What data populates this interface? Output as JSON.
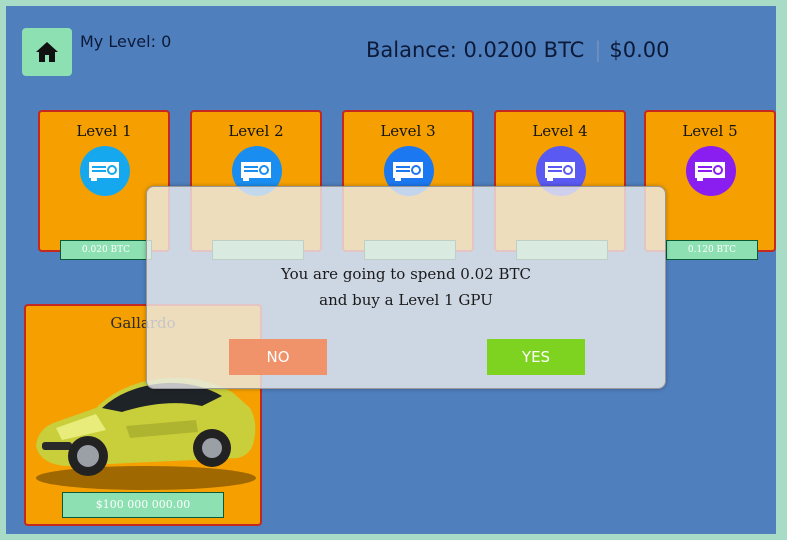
{
  "header": {
    "home_icon": "home-icon",
    "my_level": "My Level: 0",
    "balance": "Balance: 0.0200 BTC",
    "separator": "|",
    "usd": "$0.00"
  },
  "levels": [
    {
      "label": "Level 1",
      "price": "0.020 BTC",
      "color": "#16a8ee",
      "icon": "gpu-icon"
    },
    {
      "label": "Level 2",
      "price": "",
      "color": "#1a8ef0",
      "icon": "gpu-icon"
    },
    {
      "label": "Level 3",
      "price": "",
      "color": "#1c78f0",
      "icon": "gpu-icon"
    },
    {
      "label": "Level 4",
      "price": "",
      "color": "#5a5af2",
      "icon": "gpu-icon"
    },
    {
      "label": "Level 5",
      "price": "0.120 BTC",
      "color": "#8a1ef0",
      "icon": "gpu-icon"
    }
  ],
  "car": {
    "name": "Gallardo",
    "price": "$100 000 000.00"
  },
  "dialog": {
    "line1": "You are going to spend 0.02 BTC",
    "line2": "and buy a Level 1 GPU",
    "no_label": "NO",
    "yes_label": "YES"
  }
}
